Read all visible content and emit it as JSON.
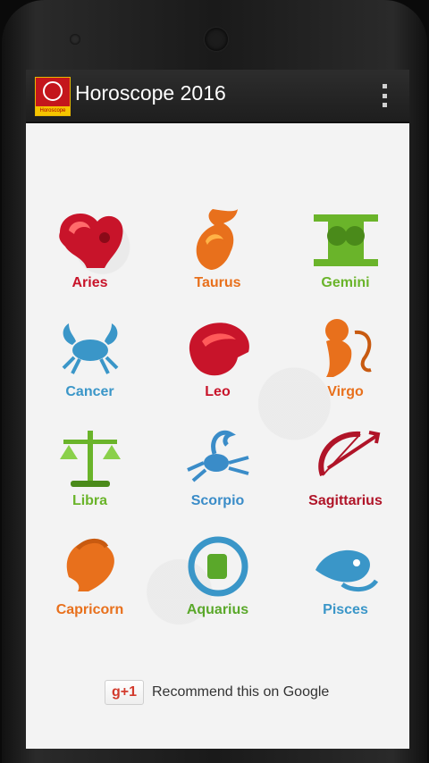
{
  "app": {
    "title": "Horoscope 2016",
    "logo_text": "Horoscope 2016"
  },
  "signs": [
    {
      "label": "Aries",
      "color": "#c8142a",
      "icon": "aries-ram-icon"
    },
    {
      "label": "Taurus",
      "color": "#e8701c",
      "icon": "taurus-bull-icon"
    },
    {
      "label": "Gemini",
      "color": "#6ab42a",
      "icon": "gemini-twins-icon"
    },
    {
      "label": "Cancer",
      "color": "#3a96c8",
      "icon": "cancer-crab-icon"
    },
    {
      "label": "Leo",
      "color": "#c8142a",
      "icon": "leo-lion-icon"
    },
    {
      "label": "Virgo",
      "color": "#e8701c",
      "icon": "virgo-maiden-icon"
    },
    {
      "label": "Libra",
      "color": "#6ab42a",
      "icon": "libra-scales-icon"
    },
    {
      "label": "Scorpio",
      "color": "#3a8cc8",
      "icon": "scorpio-scorpion-icon"
    },
    {
      "label": "Sagittarius",
      "color": "#b01428",
      "icon": "sagittarius-archer-icon"
    },
    {
      "label": "Capricorn",
      "color": "#e8701c",
      "icon": "capricorn-goat-icon"
    },
    {
      "label": "Aquarius",
      "color": "#5aa82a",
      "icon": "aquarius-water-icon"
    },
    {
      "label": "Pisces",
      "color": "#3a96c8",
      "icon": "pisces-fish-icon"
    }
  ],
  "recommend": {
    "button_label": "g+1",
    "text": "Recommend this on Google"
  }
}
